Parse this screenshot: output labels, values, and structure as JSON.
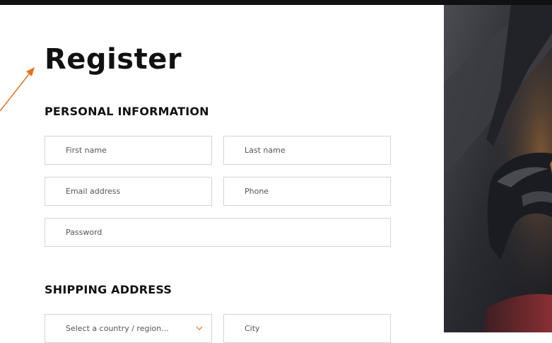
{
  "page": {
    "title": "Register"
  },
  "personal_information": {
    "heading": "PERSONAL INFORMATION",
    "first_name_placeholder": "First name",
    "last_name_placeholder": "Last name",
    "email_placeholder": "Email address",
    "phone_placeholder": "Phone",
    "password_placeholder": "Password"
  },
  "shipping_address": {
    "heading": "SHIPPING ADDRESS",
    "country_select_value": "Select a country / region...",
    "city_placeholder": "City"
  },
  "colors": {
    "accent": "#e37222",
    "border": "#d4d4d4",
    "text": "#111111"
  }
}
